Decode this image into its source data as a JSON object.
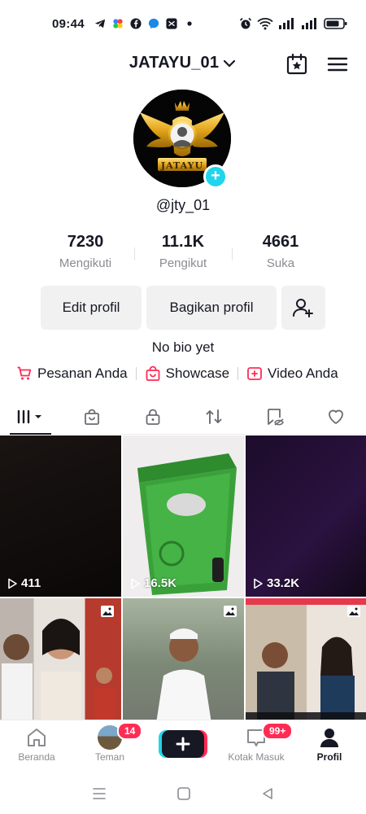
{
  "status_bar": {
    "time": "09:44",
    "left_icons": [
      "telegram-icon",
      "pinwheel-icon",
      "facebook-icon",
      "messenger-icon",
      "capcut-icon",
      "dot-icon"
    ],
    "right_icons": [
      "alarm-icon",
      "wifi-icon",
      "signal-icon",
      "signal-icon",
      "battery-icon"
    ]
  },
  "header": {
    "username": "JATAYU_01",
    "chevron": "chevron-down-icon",
    "calendar_icon": "creator-calendar-icon",
    "menu_icon": "menu-icon"
  },
  "profile": {
    "avatar_text": "JATAYU",
    "handle": "@jty_01",
    "stats": [
      {
        "value": "7230",
        "label": "Mengikuti"
      },
      {
        "value": "11.1K",
        "label": "Pengikut"
      },
      {
        "value": "4661",
        "label": "Suka"
      }
    ],
    "edit_label": "Edit profil",
    "share_label": "Bagikan profil",
    "bio": "No bio yet"
  },
  "links": [
    {
      "label": "Pesanan Anda",
      "icon": "cart-icon"
    },
    {
      "label": "Showcase",
      "icon": "shop-bag-icon"
    },
    {
      "label": "Video Anda",
      "icon": "video-plus-icon"
    }
  ],
  "tabs": [
    "grid-icon",
    "shop-bag-icon",
    "lock-icon",
    "repost-icon",
    "tagged-icon",
    "heart-icon"
  ],
  "grid": [
    {
      "views": "411",
      "bg": "#120f0e"
    },
    {
      "views": "16.5K",
      "bg": "#eceaea"
    },
    {
      "views": "33.2K",
      "bg": "#1d0f28"
    },
    {
      "views": "",
      "bg": "#cfc9c3"
    },
    {
      "views": "",
      "bg": "#8d9a86"
    },
    {
      "views": "",
      "bg": "#6c5a4e"
    }
  ],
  "bottom_nav": {
    "home": "Beranda",
    "friends": "Teman",
    "friends_badge": "14",
    "inbox": "Kotak Masuk",
    "inbox_badge": "99+",
    "profile": "Profil"
  },
  "colors": {
    "accent_red": "#fe2c55",
    "accent_cyan": "#20d5ec",
    "text": "#161823",
    "muted": "#8a8b91"
  }
}
